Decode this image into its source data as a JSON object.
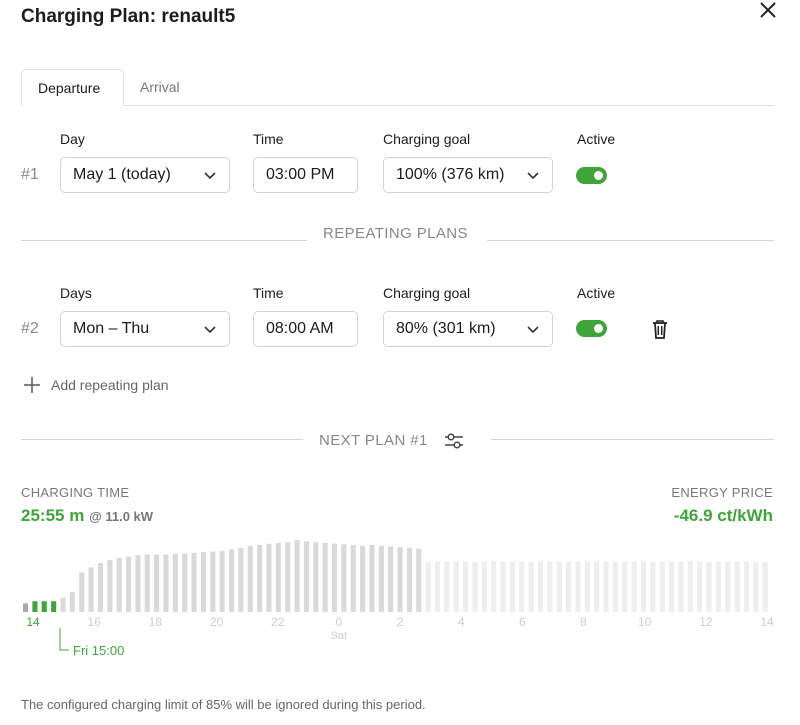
{
  "dialog": {
    "title": "Charging Plan: renault5"
  },
  "tabs": [
    {
      "label": "Departure",
      "active": true
    },
    {
      "label": "Arrival",
      "active": false
    }
  ],
  "plan1": {
    "number": "#1",
    "day_label": "Day",
    "day_value": "May 1 (today)",
    "time_label": "Time",
    "time_value": "03:00  PM",
    "goal_label": "Charging goal",
    "goal_value": "100% (376 km)",
    "active_label": "Active",
    "active": true
  },
  "repeating": {
    "divider_label": "REPEATING PLANS"
  },
  "plan2": {
    "number": "#2",
    "day_label": "Days",
    "day_value": "Mon – Thu",
    "time_label": "Time",
    "time_value": "08:00  AM",
    "goal_label": "Charging goal",
    "goal_value": "80% (301 km)",
    "active_label": "Active",
    "active": true
  },
  "add_plan": {
    "label": "Add repeating plan"
  },
  "next_plan": {
    "divider_label": "NEXT PLAN #1"
  },
  "charging_time": {
    "caption": "CHARGING TIME",
    "value": "25:55 m",
    "power": "@ 11.0 kW"
  },
  "energy_price": {
    "caption": "ENERGY PRICE",
    "value": "-46.9 ct/kWh"
  },
  "colors": {
    "accent_green": "#3fa43a",
    "bar_grey": "#d9d9d9",
    "bar_light": "#eeeeee",
    "bar_slot": "#2e7d32"
  },
  "chart_data": {
    "type": "bar",
    "x_tick_labels": [
      "14",
      "16",
      "18",
      "20",
      "22",
      "0",
      "2",
      "4",
      "6",
      "8",
      "10",
      "12",
      "14"
    ],
    "x_sublabel": "Sat",
    "marker_label": "Fri 15:00",
    "slot_count": 80,
    "current_slot_index": 0,
    "charging_slots": [
      1,
      2,
      3
    ],
    "bar_levels": [
      0.12,
      0.15,
      0.15,
      0.15,
      0.2,
      0.28,
      0.55,
      0.62,
      0.68,
      0.72,
      0.75,
      0.77,
      0.79,
      0.8,
      0.8,
      0.8,
      0.81,
      0.81,
      0.82,
      0.83,
      0.84,
      0.85,
      0.87,
      0.89,
      0.92,
      0.93,
      0.95,
      0.96,
      0.97,
      1.0,
      0.98,
      0.97,
      0.96,
      0.95,
      0.94,
      0.93,
      0.92,
      0.93,
      0.92,
      0.91,
      0.9,
      0.89,
      0.88,
      0.7,
      0.7,
      0.7,
      0.7,
      0.7,
      0.7,
      0.7,
      0.7,
      0.7,
      0.7,
      0.7,
      0.7,
      0.7,
      0.7,
      0.7,
      0.7,
      0.7,
      0.7,
      0.7,
      0.7,
      0.7,
      0.7,
      0.7,
      0.7,
      0.7,
      0.7,
      0.7,
      0.7,
      0.7,
      0.7,
      0.7,
      0.7,
      0.7,
      0.7,
      0.7,
      0.7,
      0.7
    ]
  },
  "footer": {
    "note": "The configured charging limit of 85% will be ignored during this period."
  }
}
